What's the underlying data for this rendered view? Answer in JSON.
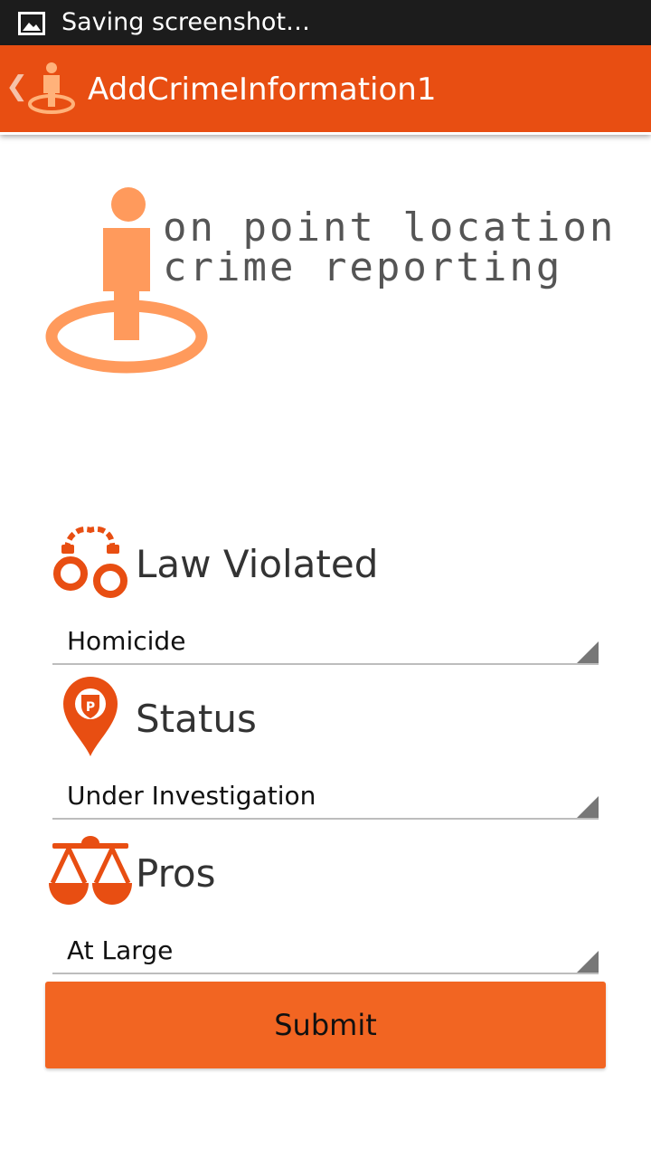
{
  "status_bar": {
    "notification_icon": "image-icon",
    "text": "Saving screenshot…"
  },
  "action_bar": {
    "up_icon": "chevron-left-icon",
    "app_icon": "person-location-pin-icon",
    "title": "AddCrimeInformation1",
    "background_color": "#e84e12"
  },
  "logo": {
    "icon": "person-location-pin-icon",
    "line1": "on point location",
    "line2": "crime reporting",
    "accent_color": "#ff9a5c"
  },
  "form": {
    "law_violated": {
      "icon": "handcuffs-icon",
      "label": "Law Violated",
      "value": "Homicide"
    },
    "status": {
      "icon": "police-location-pin-icon",
      "label": "Status",
      "value": "Under Investigation"
    },
    "pros": {
      "icon": "scales-icon",
      "label": "Pros",
      "value": "At Large"
    },
    "submit_label": "Submit",
    "submit_color": "#f26522"
  }
}
